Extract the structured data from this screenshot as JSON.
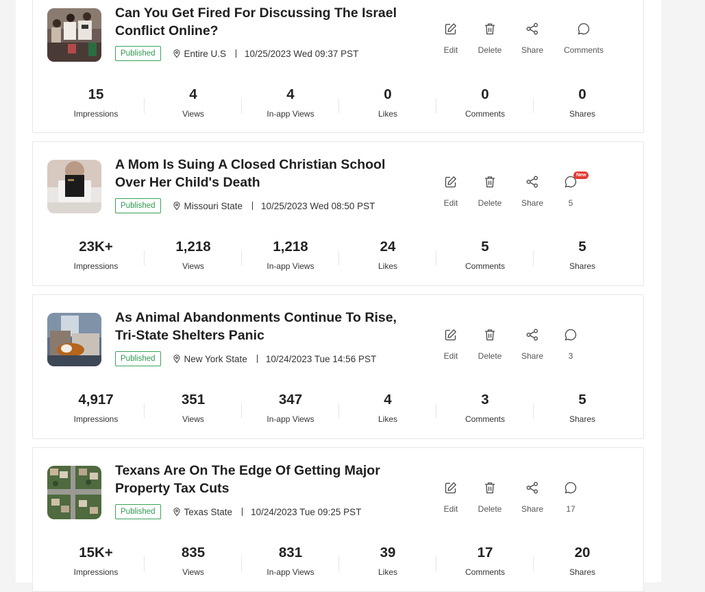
{
  "posts": [
    {
      "title": "Can You Get Fired For Discussing The Israel Conflict Online?",
      "status": "Published",
      "location": "Entire U.S",
      "datetime": "10/25/2023 Wed 09:37 PST",
      "actions": {
        "edit": "Edit",
        "delete": "Delete",
        "share": "Share",
        "comments": "Comments"
      },
      "comments_new": false,
      "stats": {
        "impressions": "15",
        "views": "4",
        "inapp_views": "4",
        "likes": "0",
        "comments": "0",
        "shares": "0"
      }
    },
    {
      "title": "A Mom Is Suing A Closed Christian School Over Her Child's Death",
      "status": "Published",
      "location": "Missouri State",
      "datetime": "10/25/2023 Wed 08:50 PST",
      "actions": {
        "edit": "Edit",
        "delete": "Delete",
        "share": "Share",
        "comments": "5"
      },
      "comments_new": true,
      "new_label": "New",
      "stats": {
        "impressions": "23K+",
        "views": "1,218",
        "inapp_views": "1,218",
        "likes": "24",
        "comments": "5",
        "shares": "5"
      }
    },
    {
      "title": "As Animal Abandonments Continue To Rise, Tri-State Shelters Panic",
      "status": "Published",
      "location": "New York State",
      "datetime": "10/24/2023 Tue 14:56 PST",
      "actions": {
        "edit": "Edit",
        "delete": "Delete",
        "share": "Share",
        "comments": "3"
      },
      "comments_new": false,
      "stats": {
        "impressions": "4,917",
        "views": "351",
        "inapp_views": "347",
        "likes": "4",
        "comments": "3",
        "shares": "5"
      }
    },
    {
      "title": "Texans Are On The Edge Of Getting Major Property Tax Cuts",
      "status": "Published",
      "location": "Texas State",
      "datetime": "10/24/2023 Tue 09:25 PST",
      "actions": {
        "edit": "Edit",
        "delete": "Delete",
        "share": "Share",
        "comments": "17"
      },
      "comments_new": false,
      "stats": {
        "impressions": "15K+",
        "views": "835",
        "inapp_views": "831",
        "likes": "39",
        "comments": "17",
        "shares": "20"
      }
    }
  ],
  "stat_labels": {
    "impressions": "Impressions",
    "views": "Views",
    "inapp_views": "In-app Views",
    "likes": "Likes",
    "comments": "Comments",
    "shares": "Shares"
  },
  "icons": {
    "edit": "edit-icon",
    "delete": "trash-icon",
    "share": "share-icon",
    "comments": "comment-bubble-icon",
    "location": "map-pin-icon"
  },
  "colors": {
    "published": "#2e9a4f",
    "new_badge": "#e53935",
    "icon": "#444444"
  }
}
